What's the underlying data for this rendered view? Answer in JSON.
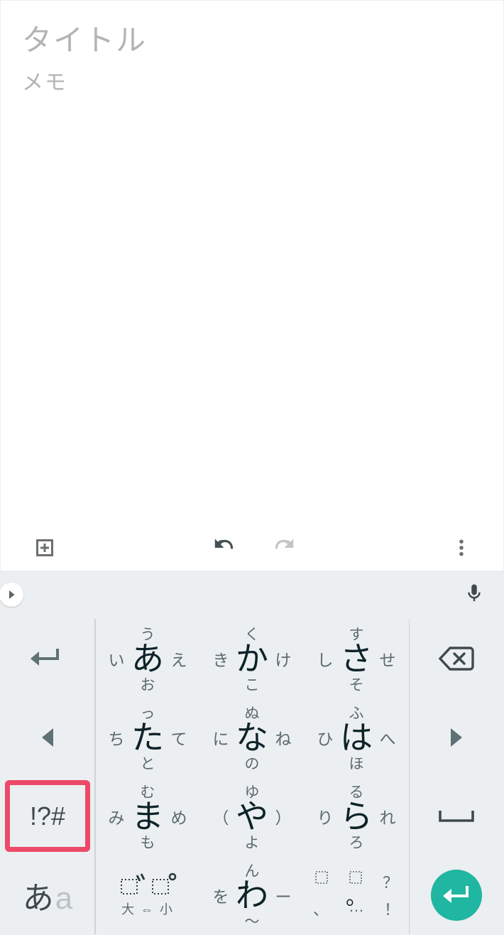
{
  "note": {
    "title_placeholder": "タイトル",
    "memo_placeholder": "メモ"
  },
  "keyboard": {
    "symbols_key_label": "!?#",
    "mode_switch": {
      "jp": "あ",
      "en": "a"
    },
    "rows": [
      [
        {
          "c": "あ",
          "t": "う",
          "b": "お",
          "l": "い",
          "r": "え"
        },
        {
          "c": "か",
          "t": "く",
          "b": "こ",
          "l": "き",
          "r": "け"
        },
        {
          "c": "さ",
          "t": "す",
          "b": "そ",
          "l": "し",
          "r": "せ"
        }
      ],
      [
        {
          "c": "た",
          "t": "っ",
          "b": "と",
          "l": "ち",
          "r": "て"
        },
        {
          "c": "な",
          "t": "ぬ",
          "b": "の",
          "l": "に",
          "r": "ね"
        },
        {
          "c": "は",
          "t": "ふ",
          "b": "ほ",
          "l": "ひ",
          "r": "へ"
        }
      ],
      [
        {
          "c": "ま",
          "t": "む",
          "b": "も",
          "l": "み",
          "r": "め"
        },
        {
          "c": "や",
          "t": "ゆ",
          "b": "よ",
          "l": "（",
          "r": "）"
        },
        {
          "c": "ら",
          "t": "る",
          "b": "ろ",
          "l": "り",
          "r": "れ"
        }
      ],
      [
        {
          "type": "dakuten",
          "top": "゛　゜",
          "bottom": "大 ⇔ 小"
        },
        {
          "c": "わ",
          "t": "ん",
          "b": "〜",
          "l": "を",
          "r": "ー"
        },
        {
          "type": "punct",
          "cells": [
            "",
            "。",
            "？",
            "、",
            "",
            "！"
          ]
        }
      ]
    ],
    "punct_extra": {
      "dotted1": "⌐",
      "dotted2": "¬",
      "dots": "…"
    }
  }
}
